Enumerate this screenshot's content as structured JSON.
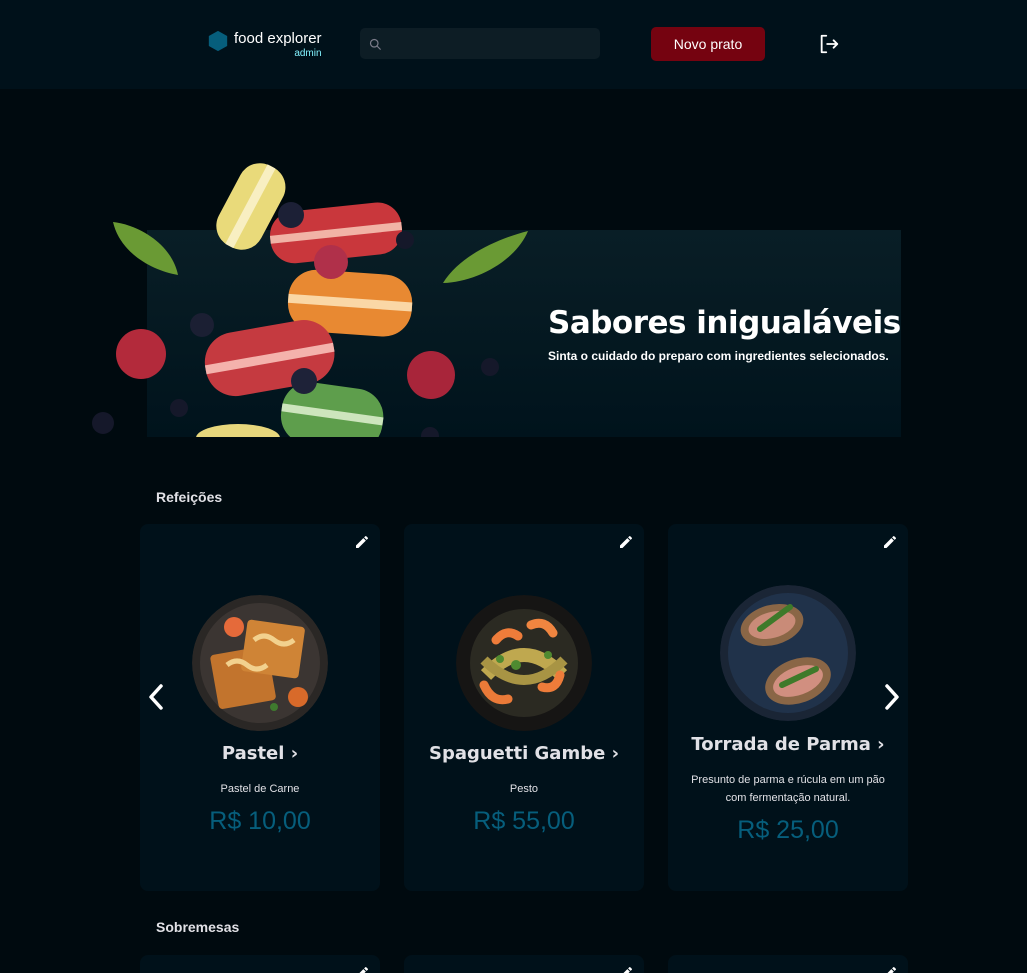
{
  "header": {
    "brand_name": "food explorer",
    "brand_role": "admin",
    "search_placeholder": "",
    "new_dish_label": "Novo prato"
  },
  "banner": {
    "title": "Sabores inigualáveis",
    "subtitle": "Sinta o cuidado do preparo com ingredientes selecionados."
  },
  "sections": [
    {
      "title": "Refeições",
      "items": [
        {
          "name": "Pastel ›",
          "description": "Pastel de Carne",
          "price": "R$ 10,00"
        },
        {
          "name": "Spaguetti Gambe ›",
          "description": "Pesto",
          "price": "R$ 55,00"
        },
        {
          "name": "Torrada de Parma ›",
          "description": "Presunto de parma e rúcula em um pão com fermentação natural.",
          "price": "R$ 25,00"
        }
      ]
    },
    {
      "title": "Sobremesas",
      "items": []
    }
  ],
  "icons": {
    "brand": "hexagon-logo-icon",
    "search": "search-icon",
    "logout": "sign-out-icon",
    "edit": "pencil-icon",
    "prev": "chevron-left-icon",
    "next": "chevron-right-icon"
  },
  "colors": {
    "background": "#000a0f",
    "header": "#00111a",
    "card": "#00111a",
    "accent_button": "#750310",
    "price": "#065e7c",
    "brand_role": "#82f3ff",
    "brand_hex": "#065e7c"
  }
}
